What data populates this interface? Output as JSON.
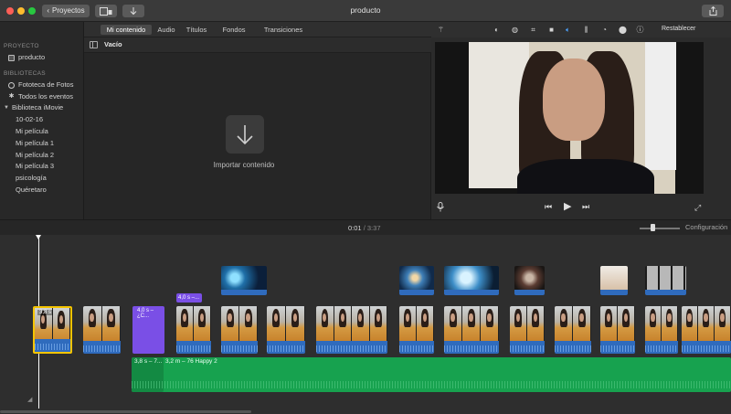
{
  "window": {
    "title": "producto",
    "back_label": "Proyectos",
    "icons": {
      "back": "chevron-left-icon",
      "media": "media-browser-icon",
      "import": "import-arrow-icon",
      "share": "share-icon"
    }
  },
  "sidebar": {
    "project_heading": "PROYECTO",
    "project_item": "producto",
    "libraries_heading": "BIBLIOTECAS",
    "library_items": [
      "Fototeca de Fotos",
      "Todos los eventos"
    ],
    "imovie_library": "Biblioteca iMovie",
    "events": [
      "10-02-16",
      "Mi película",
      "Mi película 1",
      "Mi película 2",
      "Mi película 3",
      "psicología",
      "Quéretaro"
    ]
  },
  "browser": {
    "tabs": [
      "Mi contenido",
      "Audio",
      "Títulos",
      "Fondos",
      "Transiciones"
    ],
    "active_tab": "Mi contenido",
    "filter_label": "Vacío",
    "import_label": "Importar contenido",
    "import_icon": "down-arrow-icon"
  },
  "viewer": {
    "reset_label": "Restablecer",
    "tool_icons": [
      "magic-wand-icon",
      "color-balance-icon",
      "color-correction-icon",
      "crop-icon",
      "stabilization-icon",
      "volume-icon",
      "equalizer-icon",
      "speed-icon",
      "noise-reduction-icon",
      "info-icon"
    ],
    "controls": {
      "mic": "microphone-icon",
      "prev": "skip-back-icon",
      "play": "play-icon",
      "next": "skip-forward-icon",
      "fullscreen": "expand-icon"
    }
  },
  "timeline": {
    "current_time": "0:01",
    "separator": "/",
    "duration": "3:37",
    "settings_label": "Configuración",
    "zoom_level": 0.3,
    "selected_clip_label": "3,8 s",
    "title_clip_label": "4,0 s – ¿C...",
    "small_title_label": "4,0 s –...",
    "music_head_label": "3,8 s – 7...",
    "music_label": "3,2 m – 76 Happy 2",
    "colors": {
      "video_audio": "#2f6bbd",
      "title": "#7a4fe6",
      "music": "#17a24f",
      "selection": "#f5c400"
    }
  }
}
